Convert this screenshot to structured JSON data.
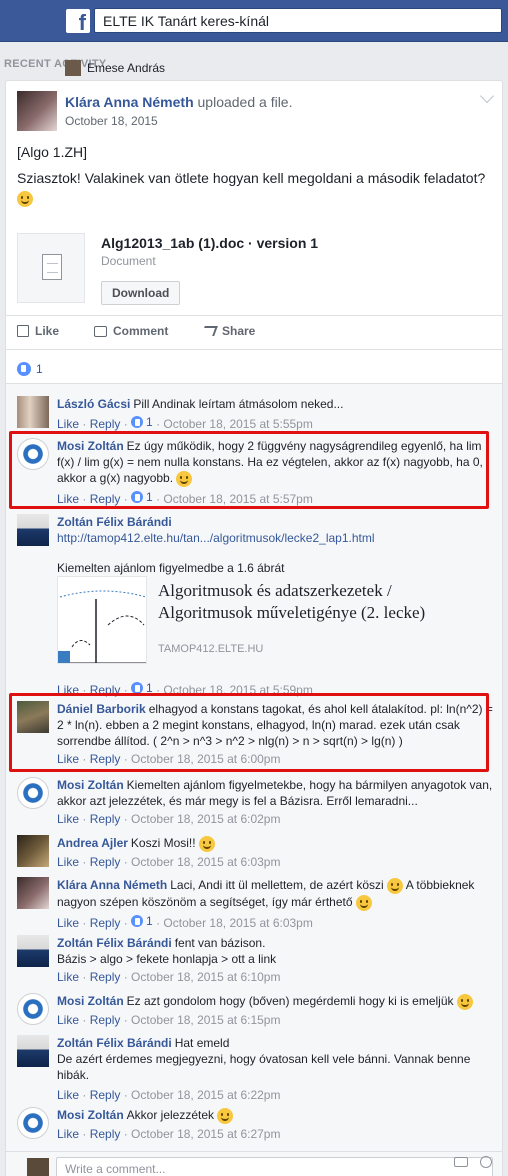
{
  "search": {
    "value": "ELTE IK Tanárt keres-kínál"
  },
  "sidebar": {
    "recent_activity": "RECENT ACTIVITY",
    "overlay_user": "Emese András"
  },
  "post": {
    "author": "Klára Anna Németh",
    "action": "uploaded a file.",
    "date": "October 18, 2015",
    "line1": "[Algo 1.ZH]",
    "line2": "Sziasztok! Valakinek van ötlete hogyan kell megoldani a második feladatot?",
    "file": {
      "name": "Alg12013_1ab (1).doc · version 1",
      "type": "Document",
      "download": "Download"
    },
    "actions": {
      "like": "Like",
      "comment": "Comment",
      "share": "Share"
    },
    "like_count": "1"
  },
  "comments": [
    {
      "name": "László Gácsi",
      "text": "Pill Andinak leírtam átmásolom neked...",
      "like": "Like",
      "reply": "Reply",
      "likes": "1",
      "time": "October 18, 2015 at 5:55pm"
    },
    {
      "name": "Mosi Zoltán",
      "text": "Ez úgy működik, hogy 2 függvény nagyságrendileg egyenlő, ha lim f(x) / lim g(x) = nem nulla konstans. Ha ez végtelen, akkor az f(x) nagyobb, ha 0, akkor a g(x) nagyobb.",
      "like": "Like",
      "reply": "Reply",
      "likes": "1",
      "time": "October 18, 2015 at 5:57pm"
    },
    {
      "name": "Zoltán Félix Bárándi",
      "text": "http://tamop412.elte.hu/tan.../algoritmusok/lecke2_lap1.html",
      "text2": "Kiemelten ajánlom figyelmedbe a 1.6 ábrát",
      "link_title": "Algoritmusok és adatszerkezetek / Algoritmusok műveletigénye (2. lecke)",
      "link_domain": "TAMOP412.ELTE.HU",
      "like": "Like",
      "reply": "Reply",
      "likes": "1",
      "time": "October 18, 2015 at 5:59pm"
    },
    {
      "name": "Dániel Barborik",
      "text": "elhagyod a konstans tagokat, és ahol kell átalakítod. pl: ln(n^2) = 2 * ln(n). ebben a 2 megint konstans, elhagyod, ln(n) marad. ezek után csak sorrendbe állítod. ( 2^n > n^3 > n^2 > nlg(n) > n > sqrt(n) > lg(n) )",
      "like": "Like",
      "reply": "Reply",
      "time": "October 18, 2015 at 6:00pm"
    },
    {
      "name": "Mosi Zoltán",
      "text": "Kiemelten ajánlom figyelmetekbe, hogy ha bármilyen anyagotok van, akkor azt jelezzétek, és már megy is fel a Bázisra. Erről lemaradni...",
      "like": "Like",
      "reply": "Reply",
      "time": "October 18, 2015 at 6:02pm"
    },
    {
      "name": "Andrea Ajler",
      "text": "Koszi Mosi!!",
      "like": "Like",
      "reply": "Reply",
      "time": "October 18, 2015 at 6:03pm"
    },
    {
      "name": "Klára Anna Németh",
      "text": "Laci, Andi itt ül mellettem, de azért köszi",
      "text_b": "A többieknek nagyon szépen köszönöm a segítséget, így már érthető",
      "like": "Like",
      "reply": "Reply",
      "likes": "1",
      "time": "October 18, 2015 at 6:03pm"
    },
    {
      "name": "Zoltán Félix Bárándi",
      "text": "fent van bázison.",
      "text2": "Bázis > algo > fekete honlapja > ott a link",
      "like": "Like",
      "reply": "Reply",
      "time": "October 18, 2015 at 6:10pm"
    },
    {
      "name": "Mosi Zoltán",
      "text": "Ez azt gondolom hogy (bőven) megérdemli hogy ki is emeljük",
      "like": "Like",
      "reply": "Reply",
      "time": "October 18, 2015 at 6:15pm"
    },
    {
      "name": "Zoltán Félix Bárándi",
      "text": "Hat emeld",
      "text2": "De azért érdemes megjegyezni, hogy óvatosan kell vele bánni. Vannak benne hibák.",
      "like": "Like",
      "reply": "Reply",
      "time": "October 18, 2015 at 6:22pm"
    },
    {
      "name": "Mosi Zoltán",
      "text": "Akkor jelezzétek",
      "like": "Like",
      "reply": "Reply",
      "time": "October 18, 2015 at 6:27pm"
    }
  ],
  "composer": {
    "placeholder": "Write a comment..."
  }
}
